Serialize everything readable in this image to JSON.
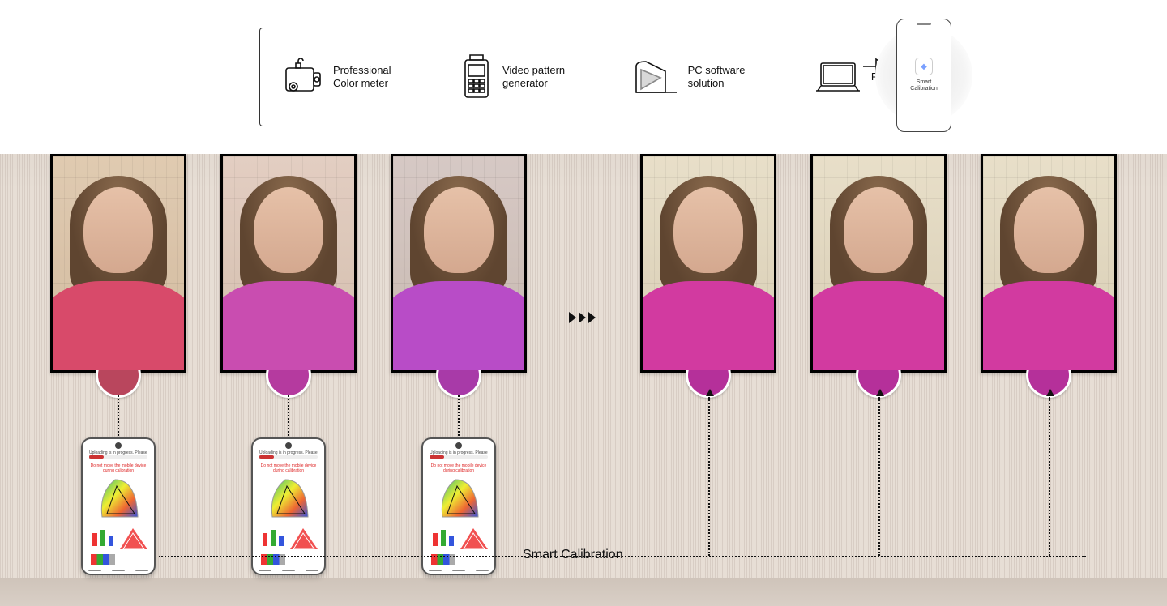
{
  "equipment": {
    "color_meter": "Professional\nColor meter",
    "pattern_gen": "Video pattern\ngenerator",
    "pc_software": "PC software\nsolution",
    "pc": "PC"
  },
  "top_phone_app": "Smart\nCalibration",
  "phone_status_title": "Uploading is in progress. Please hold.",
  "phone_warning": "Do not move the mobile device during calibration",
  "smart_calibration_label": "Smart Calibration",
  "panels_before": [
    {
      "dot": "#b9465d",
      "blazer": "#d84a6a",
      "tint": "rgba(220,150,120,0.22)"
    },
    {
      "dot": "#b53a9f",
      "blazer": "#c94db0",
      "tint": "rgba(230,160,210,0.20)"
    },
    {
      "dot": "#a83aa8",
      "blazer": "#b84cc7",
      "tint": "rgba(160,130,230,0.20)"
    }
  ],
  "panels_after": [
    {
      "dot": "#b5309a",
      "blazer": "#d23aa0"
    },
    {
      "dot": "#b5309a",
      "blazer": "#d23aa0"
    },
    {
      "dot": "#b5309a",
      "blazer": "#d23aa0"
    }
  ]
}
